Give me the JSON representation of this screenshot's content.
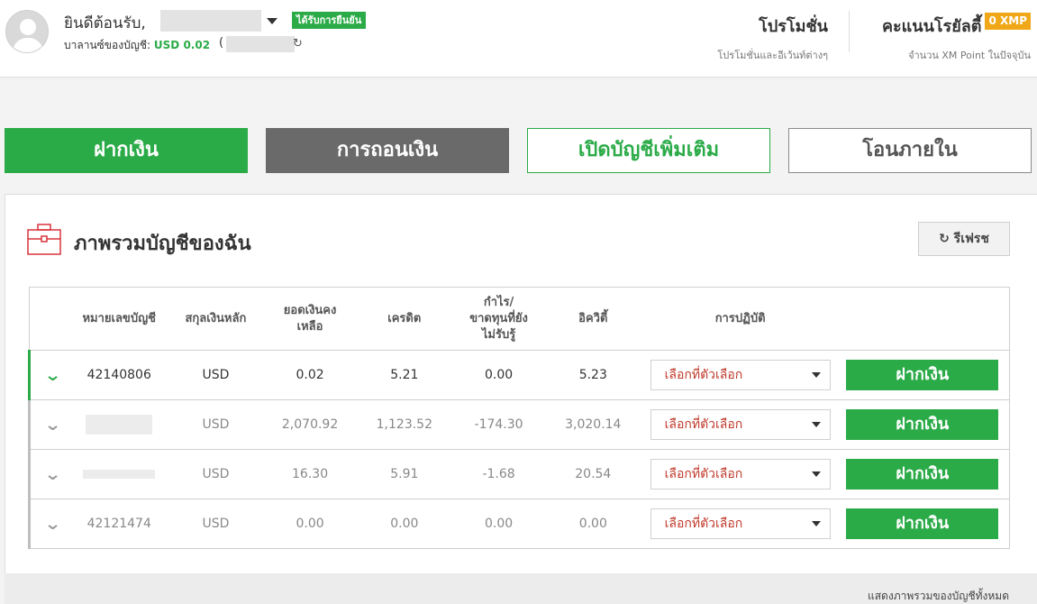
{
  "header": {
    "welcome": "ยินดีต้อนรับ,",
    "verified_badge": "ได้รับการยืนยัน",
    "balance_label": "บาลานซ์ของบัญชี:",
    "balance_value": "USD 0.02",
    "paren": "(",
    "promo_title": "โปรโมชั่น",
    "promo_sub": "โปรโมชั่นและอีเว้นท์ต่างๆ",
    "loyalty_title": "คะแนนโรยัลตี้",
    "loyalty_badge": "0 XMP",
    "loyalty_sub": "จำนวน XM Point ในปัจจุบัน"
  },
  "actions": {
    "deposit": "ฝากเงิน",
    "withdraw": "การถอนเงิน",
    "open_account": "เปิดบัญชีเพิ่มเติม",
    "internal_transfer": "โอนภายใน"
  },
  "overview": {
    "title": "ภาพรวมบัญชีของฉัน",
    "refresh": "รีเฟรช",
    "columns": {
      "account": "หมายเลขบัญชี",
      "currency": "สกุลเงินหลัก",
      "balance": "ยอดเงินคงเหลือ",
      "credit": "เครดิต",
      "pnl": "กำไร/ขาดทุนที่ยังไม่รับรู้",
      "equity": "อิควิตี้",
      "actions": "การปฏิบัติ"
    },
    "rows": [
      {
        "account": "42140806",
        "currency": "USD",
        "balance": "0.02",
        "credit": "5.21",
        "pnl": "0.00",
        "equity": "5.23",
        "select": "เลือกที่ตัวเลือก",
        "deposit": "ฝากเงิน"
      },
      {
        "account": "",
        "currency": "USD",
        "balance": "2,070.92",
        "credit": "1,123.52",
        "pnl": "-174.30",
        "equity": "3,020.14",
        "select": "เลือกที่ตัวเลือก",
        "deposit": "ฝากเงิน"
      },
      {
        "account": "",
        "currency": "USD",
        "balance": "16.30",
        "credit": "5.91",
        "pnl": "-1.68",
        "equity": "20.54",
        "select": "เลือกที่ตัวเลือก",
        "deposit": "ฝากเงิน"
      },
      {
        "account": "42121474",
        "currency": "USD",
        "balance": "0.00",
        "credit": "0.00",
        "pnl": "0.00",
        "equity": "0.00",
        "select": "เลือกที่ตัวเลือก",
        "deposit": "ฝากเงิน"
      }
    ],
    "show_all": "แสดงภาพรวมของบัญชีทั้งหมด"
  },
  "colors": {
    "brand_green": "#2bab48",
    "withdraw_gray": "#6a6a6a",
    "loyalty_orange": "#f0a818",
    "select_red": "#c0392b"
  },
  "icons": [
    "user-avatar-icon",
    "caret-down-icon",
    "refresh-icon",
    "briefcase-icon",
    "chevron-down-icon"
  ]
}
